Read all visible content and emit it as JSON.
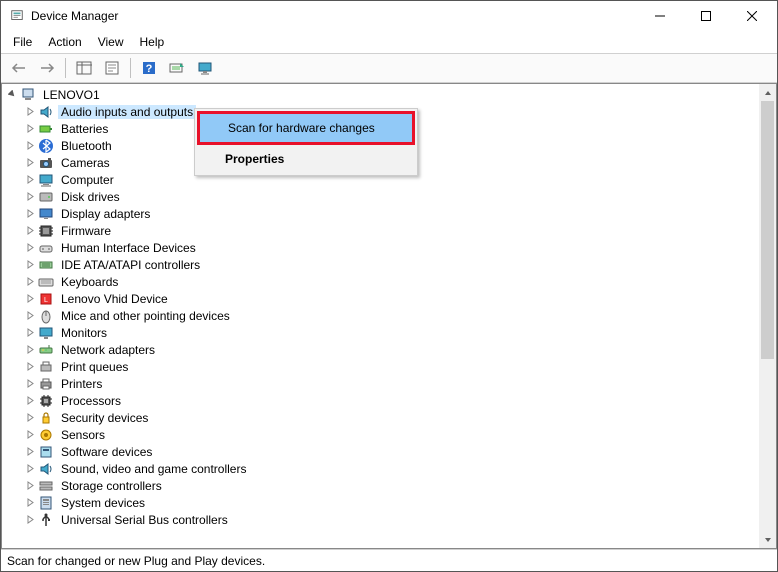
{
  "window": {
    "title": "Device Manager"
  },
  "menubar": {
    "file": "File",
    "action": "Action",
    "view": "View",
    "help": "Help"
  },
  "tree": {
    "root": "LENOVO1",
    "items": [
      "Audio inputs and outputs",
      "Batteries",
      "Bluetooth",
      "Cameras",
      "Computer",
      "Disk drives",
      "Display adapters",
      "Firmware",
      "Human Interface Devices",
      "IDE ATA/ATAPI controllers",
      "Keyboards",
      "Lenovo Vhid Device",
      "Mice and other pointing devices",
      "Monitors",
      "Network adapters",
      "Print queues",
      "Printers",
      "Processors",
      "Security devices",
      "Sensors",
      "Software devices",
      "Sound, video and game controllers",
      "Storage controllers",
      "System devices",
      "Universal Serial Bus controllers"
    ],
    "selected_index": 0
  },
  "context_menu": {
    "scan": "Scan for hardware changes",
    "properties": "Properties"
  },
  "statusbar": {
    "text": "Scan for changed or new Plug and Play devices."
  }
}
